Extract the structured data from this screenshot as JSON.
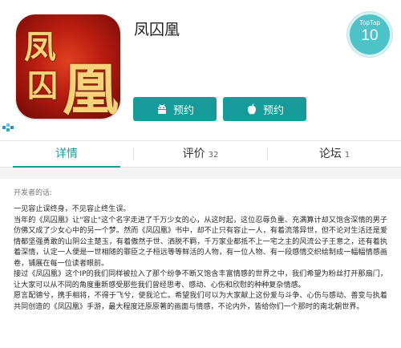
{
  "app": {
    "title": "凤囚凰",
    "icon": {
      "name": "app-icon",
      "glyphs": [
        "凤",
        "囚",
        "凰"
      ]
    }
  },
  "buttons": {
    "android": {
      "label": "预约",
      "icon": "android-icon"
    },
    "ios": {
      "label": "预约",
      "icon": "apple-icon"
    }
  },
  "badge": {
    "tag": "TopTap",
    "rank": "10"
  },
  "tabs": [
    {
      "label": "详情",
      "count": "",
      "active": true
    },
    {
      "label": "评价",
      "count": "32",
      "active": false
    },
    {
      "label": "论坛",
      "count": "1",
      "active": false
    }
  ],
  "content": {
    "dev_label": "开发者的话:",
    "paragraphs": [
      "一见容止误终身，不见容止终生误。",
      "当年的《凤囚凰》让\"容止\"这个名字走进了千万少女的心，从这时起，这位忍辱负重、充满算计却又饱含深情的男子仿佛又成了少女心中的另一个梦。然而《凤囚凰》书中，却不止只有容止一人，有着流落异世，但不论对生活还是爱情都坚强勇敢的山阴公主楚玉，有着傲然于世、洒脱不羁，千万家业都抵不上一宅之主的风流公子王意之，还有着执着深情，认定一人便是一世相随的罪臣之子桓远等等鲜活的人物，有一位人物、有一段感情交织绘制成一幅幅情感画卷，铺展在每一位读者眼前。",
      "接过《凤囚凰》这个IP的我们同样被拉入了那个纷争不断又饱含丰富情感的世界之中，我们希望为粉丝打开那扇门，让大家可以从不同的角度重新感受那些我们曾经思考、感动、心伤和欣慰的种种复杂情感。",
      "愿言配德兮，携手相将，不得于飞兮，使我沦亡。希望我们可以为大家献上这份爱与斗争、心伤与感动、善变与执着共同创造的《凤囚凰》手游，最大程度还原原著的画面与情感，不论内外，皆给你们一个那时的南北朝世界。"
    ]
  },
  "colors": {
    "accent": "#169b9a",
    "badge": "#4dc3c8",
    "icon_red": "#b81c10",
    "icon_gold": "#f6d27a"
  }
}
